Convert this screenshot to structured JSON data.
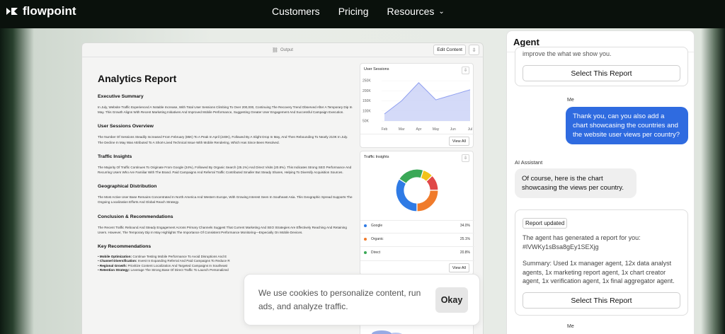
{
  "nav": {
    "brand": "flowpoint",
    "links": [
      "Customers",
      "Pricing",
      "Resources"
    ]
  },
  "output_window": {
    "title": "Output",
    "edit_label": "Edit Content"
  },
  "report": {
    "title": "Analytics Report",
    "sections": [
      {
        "heading": "Executive Summary",
        "body": "In July, Website Traffic Experienced A Notable Increase, With Total User Sessions Climbing To Over 200,000, Continuing The Recovery Trend Observed After A Temporary Dip In May. This Growth Aligns With Recent Marketing Initiatives And Improved Mobile Performance, Suggesting Greater User Engagement And Successful Campaign Execution."
      },
      {
        "heading": "User Sessions Overview",
        "body": "The Number Of Sessions Steadily Increased From February (85K) To A Peak In April (240K), Followed By A Slight Drop In May, And Then Rebounding To Nearly 210K In July. The Decline In May Was Attributed To A Short-Lived Technical Issue With Mobile Rendering, Which Has Since Been Resolved."
      },
      {
        "heading": "Traffic Insights",
        "body": "The Majority Of Traffic Continues To Originate From Google (34%), Followed By Organic Search (25.1%) And Direct Visits (20.8%). This Indicates Strong SEO Performance And Recurring Users Who Are Familiar With The Brand. Paid Campaigns And Referral Traffic Contributed Smaller But Steady Shares, Helping To Diversify Acquisition Sources."
      },
      {
        "heading": "Geographical Distribution",
        "body": "The Most Active User Base Remains Concentrated In North America And Western Europe, With Growing Interest Seen In Southeast Asia. This Geographic Spread Supports The Ongoing Localization Efforts And Global Reach Strategy."
      },
      {
        "heading": "Conclusion & Recommendations",
        "body": "The Recent Traffic Rebound And Steady Engagement Across Primary Channels Suggest That Current Marketing And SEO Strategies Are Effectively Reaching And Retaining Users. However, The Temporary Dip In May Highlights The Importance Of Consistent Performance Monitoring—Especially On Mobile Devices."
      }
    ],
    "recommendations_heading": "Key Recommendations",
    "recommendations": [
      {
        "label": "Mobile Optimization:",
        "text": "Continue Testing Mobile Performance To Avoid Disruptions And E"
      },
      {
        "label": "Channel Diversification:",
        "text": "Invest In Expanding Referral And Paid Campaigns To Reduce R"
      },
      {
        "label": "Regional Growth:",
        "text": "Prioritize Content Localization And Targeted Campaigns In Southeast"
      },
      {
        "label": "Retention Strategy:",
        "text": "Leverage The Strong Base Of Direct Traffic To Launch Personalized"
      }
    ]
  },
  "sessions_card": {
    "title": "User Sessions",
    "view_all": "View All"
  },
  "traffic_card": {
    "title": "Traffic Insights",
    "view_all": "View All",
    "legend": [
      {
        "name": "Google",
        "value": "34.0%",
        "color": "#2f7be5"
      },
      {
        "name": "Organic",
        "value": "25.1%",
        "color": "#f07b2b"
      },
      {
        "name": "Direct",
        "value": "20.8%",
        "color": "#3aa857"
      }
    ]
  },
  "chart_data": [
    {
      "type": "area",
      "title": "User Sessions",
      "categories": [
        "Feb",
        "Mar",
        "Apr",
        "May",
        "Jun",
        "Jul"
      ],
      "values": [
        85,
        150,
        240,
        155,
        180,
        205
      ],
      "y_ticks": [
        "250K",
        "200K",
        "150K",
        "100K",
        "50K"
      ],
      "ylim": [
        50,
        250
      ],
      "color": "#8f9ff0"
    },
    {
      "type": "pie",
      "title": "Traffic Insights",
      "slices": [
        {
          "name": "Google",
          "value": 34.0,
          "color": "#2f7be5"
        },
        {
          "name": "Organic",
          "value": 25.1,
          "color": "#f07b2b"
        },
        {
          "name": "Direct",
          "value": 20.8,
          "color": "#3aa857"
        },
        {
          "value": 8.0,
          "color": "#f2c318"
        },
        {
          "value": 12.1,
          "color": "#e04848"
        }
      ]
    }
  ],
  "agent": {
    "title": "Agent",
    "partial_text": "improve the what we show you.",
    "select_label": "Select This Report",
    "me_label": "Me",
    "user_message": "Thank you, can you also add a chart showcasing the countries and the website user views per country?",
    "ai_label": "AI Assistant",
    "ai_message": "Of course, here is the chart showcasing the views per country.",
    "report_badge": "Report updated",
    "report_text": "The agent has generated a report for you: #lVWKy1sBsa8gEy1SEXjg",
    "summary_text": "Summary: Used 1x manager agent, 12x data analyst agents, 1x marketing report agent, 1x chart creator agent, 1x verification agent, 1x final aggregator agent."
  },
  "cookie": {
    "text": "We use cookies to personalize content, run ads, and analyze traffic.",
    "button": "Okay"
  }
}
